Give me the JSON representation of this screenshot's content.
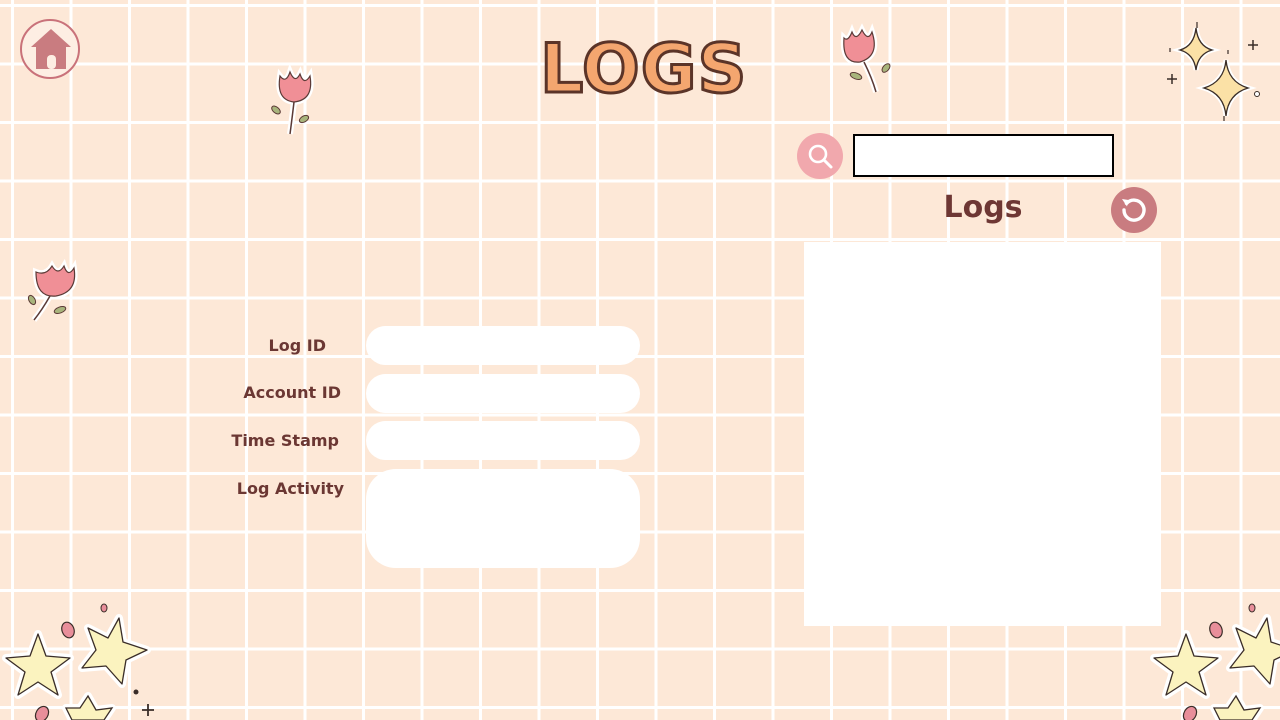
{
  "page": {
    "title": "LOGS"
  },
  "search": {
    "value": "",
    "placeholder": ""
  },
  "logs_panel": {
    "heading": "Logs",
    "entries": []
  },
  "form": {
    "log_id_label": "Log ID",
    "account_id_label": "Account ID",
    "time_stamp_label": "Time Stamp",
    "log_activity_label": "Log Activity",
    "log_id_value": "",
    "account_id_value": "",
    "time_stamp_value": "",
    "log_activity_value": ""
  },
  "icons": {
    "home": "home-icon",
    "search": "search-icon",
    "refresh": "refresh-icon"
  },
  "colors": {
    "background": "#fde8d7",
    "grid": "#ffffff",
    "title_fill": "#f4a66f",
    "title_stroke": "#5b3428",
    "label_text": "#6b3733",
    "search_button": "#f1a8ad",
    "refresh_button": "#c97c80",
    "home_icon": "#c97c80"
  }
}
